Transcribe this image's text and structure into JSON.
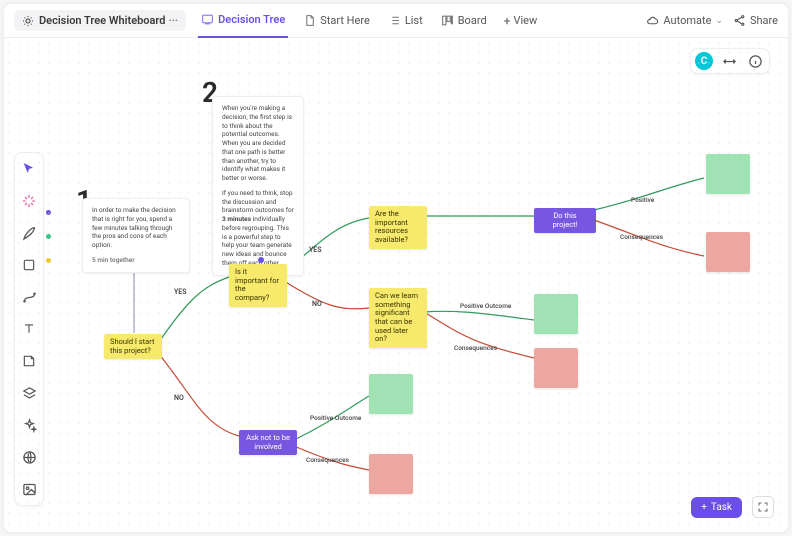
{
  "header": {
    "title": "Decision Tree Whiteboard",
    "tabs": [
      {
        "label": "Decision Tree",
        "icon": "whiteboard-icon",
        "active": true
      },
      {
        "label": "Start Here",
        "icon": "doc-icon"
      },
      {
        "label": "List",
        "icon": "list-icon"
      },
      {
        "label": "Board",
        "icon": "board-icon"
      }
    ],
    "add_view_label": "View",
    "automate_label": "Automate",
    "share_label": "Share"
  },
  "avatar_row": {
    "avatar_letter": "C"
  },
  "left_toolbar": {
    "tools": [
      "select",
      "spark",
      "pen",
      "shape",
      "connector",
      "text",
      "sticky",
      "group",
      "ai",
      "web",
      "image"
    ]
  },
  "big_numbers": {
    "one": "1",
    "two": "2"
  },
  "note1": {
    "body": "In order to make the decision that is right for you, spend a few minutes talking through the pros and cons of each option.",
    "mins": "5 min together"
  },
  "note2": {
    "p1": "When you're making a decision, the first step is to think about the potential outcomes. When you are decided that one path is better than another, try to identify what makes it better or worse.",
    "p2_a": "If you need to think, stop the discussion and brainstorm outcomes for ",
    "p2_bold": "3 minutes",
    "p2_b": " individually before regrouping. This is a powerful step to help your team generate new ideas and bounce them off each other."
  },
  "nodes": {
    "start": "Should I start this project?",
    "important": "Is it important for the company?",
    "resources": "Are the important resources available?",
    "do_project": "Do this project!",
    "learn": "Can we learn something significant that can be used later on?",
    "ask_not": "Ask not to be involved"
  },
  "edge_labels": {
    "yes": "YES",
    "no": "NO",
    "positive_outcome": "Positive Outcome",
    "consequences": "Consequences",
    "positive": "Positive"
  },
  "bottom": {
    "task_label": "Task"
  },
  "colors": {
    "accent": "#6b4ee6",
    "yes": "#2f9a5a",
    "no": "#c24b36",
    "card_yellow": "#f6e96b",
    "card_purple": "#7757e0",
    "card_green": "#a0e2b4",
    "card_red": "#eca7a1"
  }
}
